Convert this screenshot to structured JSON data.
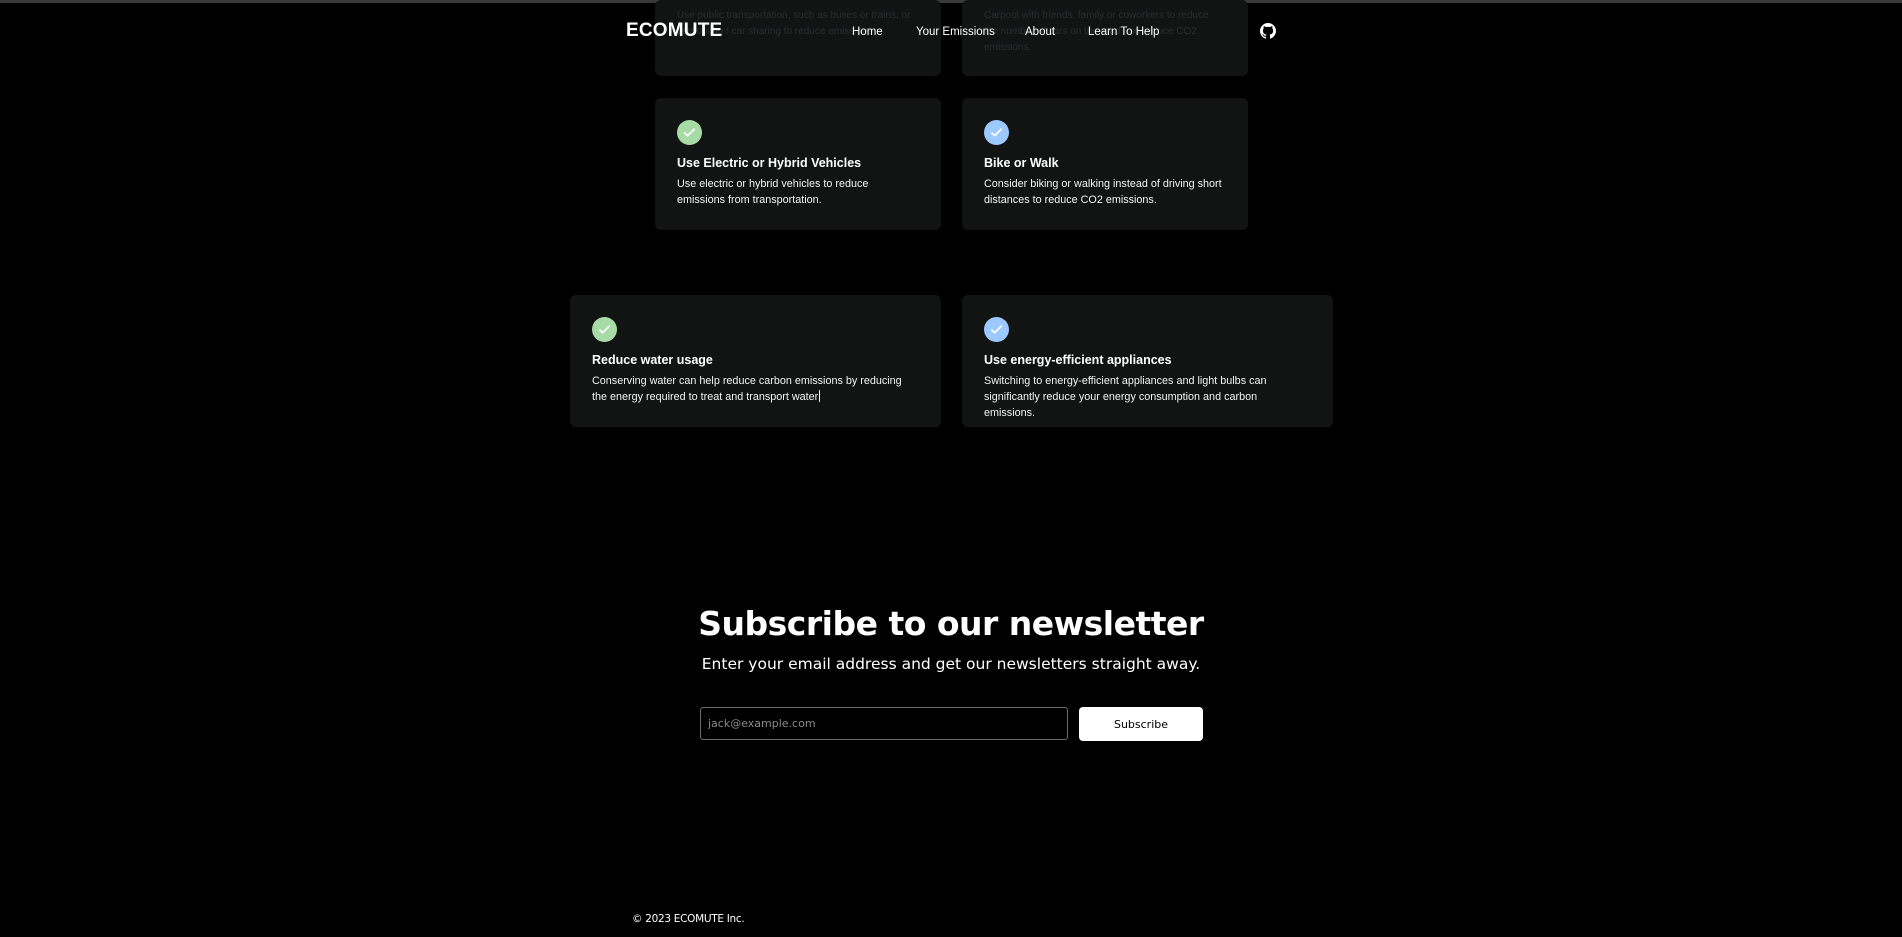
{
  "brand": "ECOMUTE",
  "nav": {
    "links": [
      "Home",
      "Your Emissions",
      "About",
      "Learn To Help"
    ],
    "github_icon": "github-icon"
  },
  "faded_cards": [
    "Use public transportation, such as buses or trains, or carpooling / car sharing to reduce emissions",
    "Carpool with friends, family or coworkers to reduce the number of cars on the road and reduce CO2 emissions."
  ],
  "tips": [
    {
      "title": "Use Electric or Hybrid Vehicles",
      "text": "Use electric or hybrid vehicles to reduce emissions from transportation.",
      "icon": "check-circle-icon",
      "color": "#a8dca6"
    },
    {
      "title": "Bike or Walk",
      "text": "Consider biking or walking instead of driving short distances to reduce CO2 emissions.",
      "icon": "check-circle-icon",
      "color": "#9cc9ff"
    },
    {
      "title": "Reduce water usage",
      "text": "Conserving water can help reduce carbon emissions by reducing the energy required to treat and transport water",
      "icon": "check-circle-icon",
      "color": "#a8dca6"
    },
    {
      "title": "Use energy-efficient appliances",
      "text": "Switching to energy-efficient appliances and light bulbs can significantly reduce your energy consumption and carbon emissions.",
      "icon": "check-circle-icon",
      "color": "#9cc9ff"
    }
  ],
  "newsletter": {
    "title": "Subscribe to our newsletter",
    "subtitle": "Enter your email address and get our newsletters straight away.",
    "placeholder": "jack@example.com",
    "button": "Subscribe"
  },
  "footer": "© 2023 ECOMUTE Inc."
}
